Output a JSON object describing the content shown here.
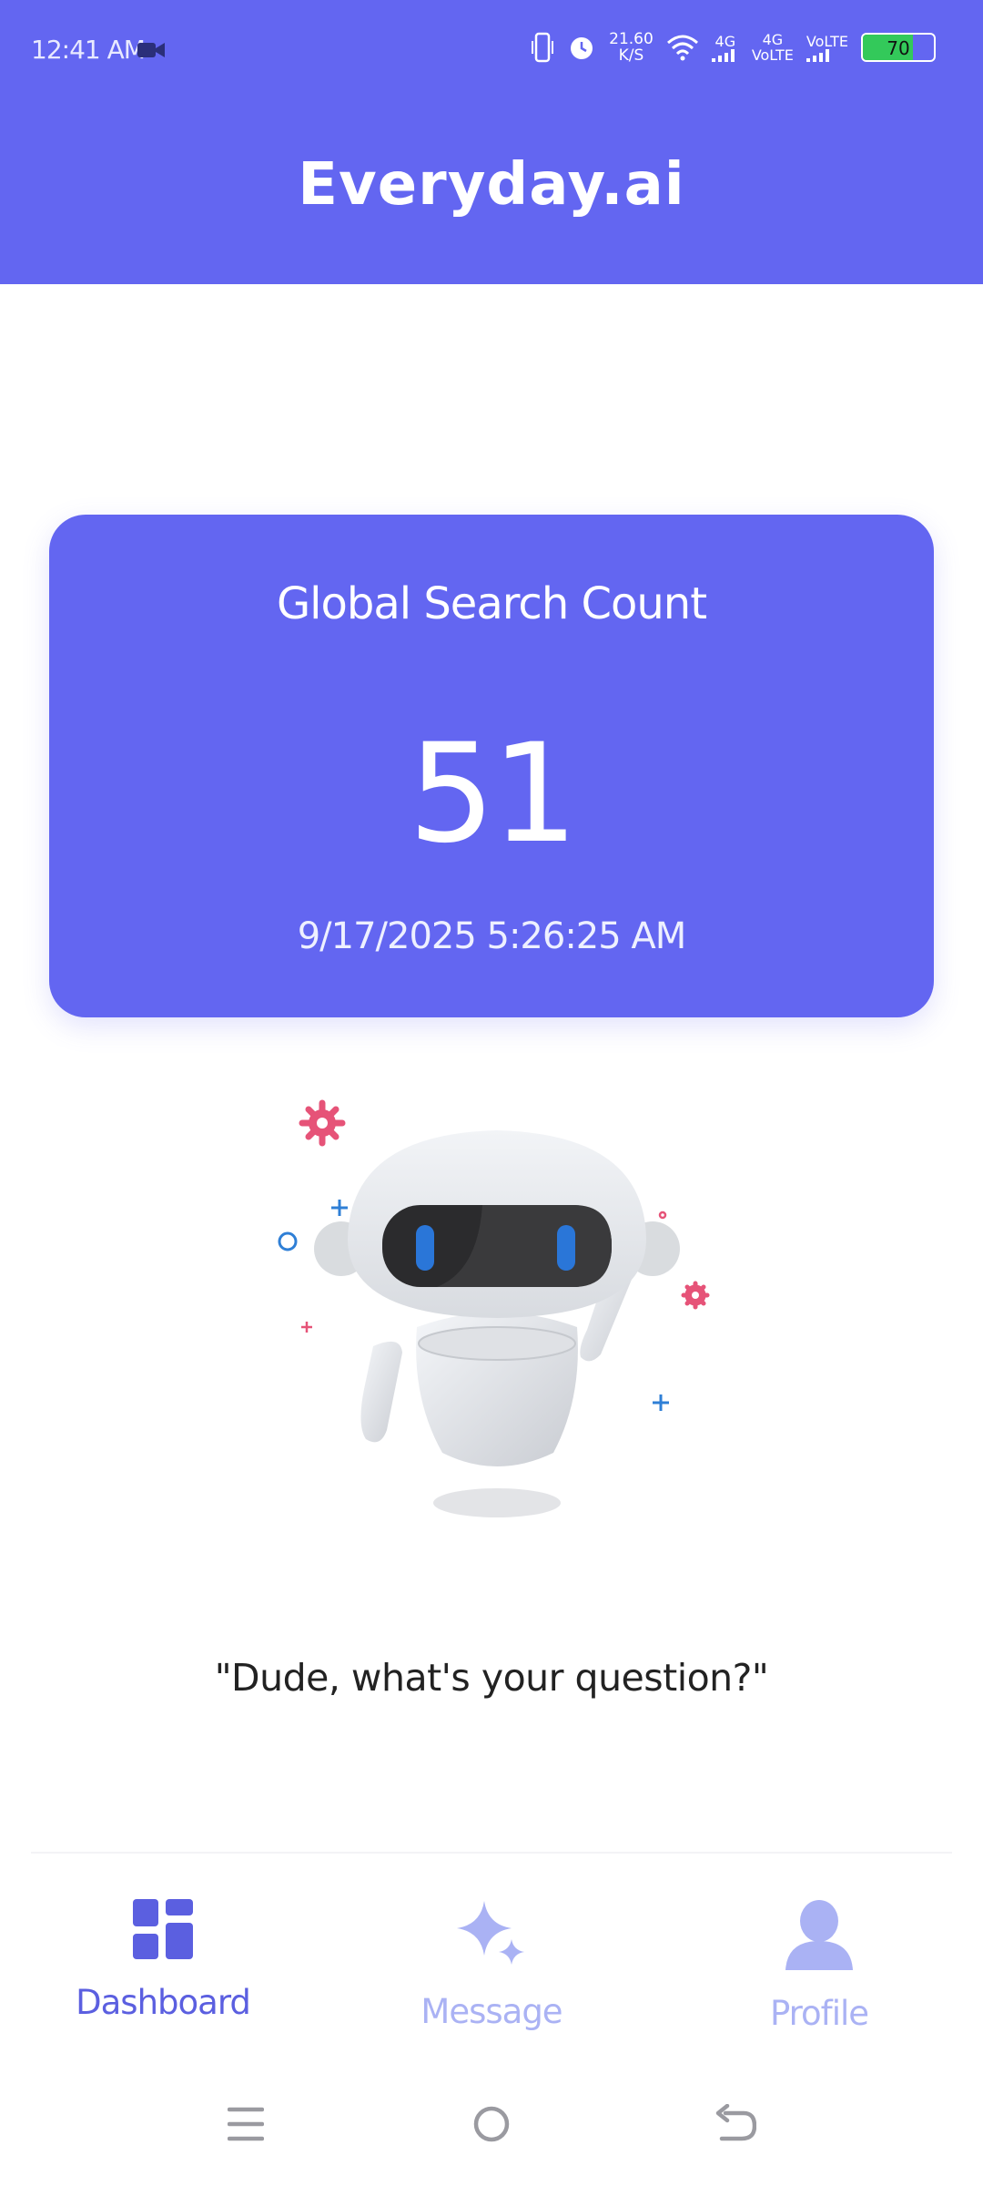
{
  "status_bar": {
    "time": "12:41 AM",
    "net_speed_value": "21.60",
    "net_speed_unit": "K/S",
    "network_1": "4G",
    "network_2": "4G",
    "volte_1": "VoLTE",
    "volte_2": "VoLTE",
    "battery": "70",
    "icons": [
      "video-camera-icon",
      "vibrate-icon",
      "alarm-icon",
      "wifi-icon",
      "signal-icon",
      "battery-icon"
    ]
  },
  "header": {
    "title": "Everyday.ai",
    "background": "#6366f1"
  },
  "stats_card": {
    "title": "Global Search Count",
    "count": "51",
    "timestamp": "9/17/2025 5:26:25 AM",
    "background": "#6366f1"
  },
  "illustration": {
    "icon": "robot-icon"
  },
  "quote": "\"Dude, what's your question?\"",
  "bottom_nav": {
    "items": [
      {
        "label": "Dashboard",
        "icon": "dashboard-icon",
        "active": true
      },
      {
        "label": "Message",
        "icon": "sparkle-icon",
        "active": false
      },
      {
        "label": "Profile",
        "icon": "user-icon",
        "active": false
      }
    ],
    "active_color": "#5b5fe0",
    "inactive_color": "#aab2f4"
  },
  "system_nav": {
    "icons": [
      "menu-icon",
      "home-icon",
      "back-icon"
    ]
  }
}
